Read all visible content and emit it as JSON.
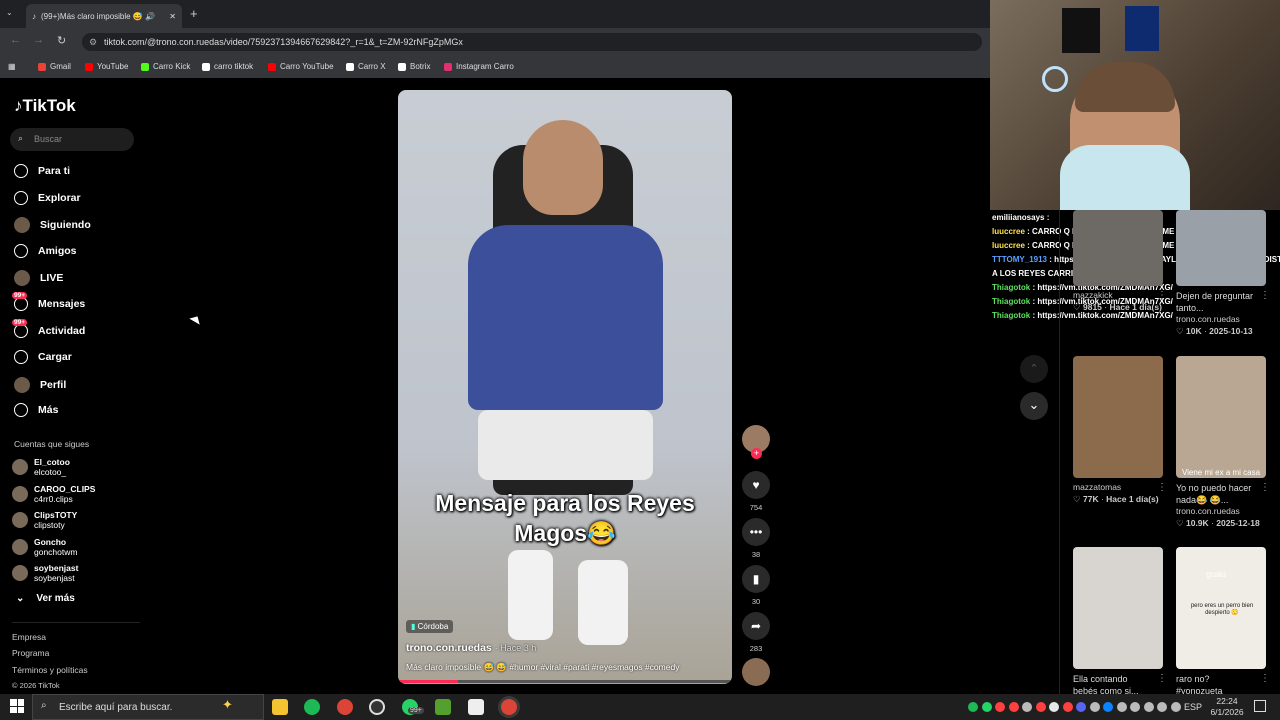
{
  "browser": {
    "tab_title": "(99+)Más claro imposible 😅 🔊",
    "url": "tiktok.com/@trono.con.ruedas/video/7592371394667629842?_r=1&_t=ZM-92rNFgZpMGx",
    "bookmarks": [
      {
        "label": "Gmail",
        "color": "#ea4335"
      },
      {
        "label": "YouTube",
        "color": "#ff0000"
      },
      {
        "label": "Carro Kick",
        "color": "#53fc18"
      },
      {
        "label": "carro tiktok",
        "color": "#ffffff"
      },
      {
        "label": "Carro YouTube",
        "color": "#ff0000"
      },
      {
        "label": "Carro X",
        "color": "#ffffff"
      },
      {
        "label": "Botrix",
        "color": "#ffffff"
      },
      {
        "label": "Instagram Carro",
        "color": "#e1306c"
      }
    ]
  },
  "tiktok": {
    "logo": "TikTok",
    "search_placeholder": "Buscar",
    "nav": [
      "Para ti",
      "Explorar",
      "Siguiendo",
      "Amigos",
      "LIVE",
      "Mensajes",
      "Actividad",
      "Cargar",
      "Perfil",
      "Más"
    ],
    "badge": "99+",
    "following_title": "Cuentas que sigues",
    "following": [
      {
        "name": "El_cotoo",
        "handle": "elcotoo_"
      },
      {
        "name": "CAROO_CLIPS",
        "handle": "c4rr0.clips"
      },
      {
        "name": "ClipsTOTY",
        "handle": "clipstoty"
      },
      {
        "name": "Goncho",
        "handle": "gonchotwm"
      },
      {
        "name": "soybenjast",
        "handle": "soybenjast"
      }
    ],
    "see_more": "Ver más",
    "footer": [
      "Empresa",
      "Programa",
      "Términos y políticas",
      "© 2026 TikTok"
    ]
  },
  "video": {
    "overlay_text": "Mensaje para los Reyes Magos😂",
    "location": "Córdoba",
    "author": "trono.con.ruedas",
    "time": "· Hace 3 h",
    "caption": "Más claro imposible 😅 😅 #humor #viral #parati #reyesmagos #comedy",
    "actions": [
      {
        "icon": "heart-icon",
        "glyph": "♥",
        "count": "754"
      },
      {
        "icon": "comment-icon",
        "glyph": "•••",
        "count": "38"
      },
      {
        "icon": "bookmark-icon",
        "glyph": "▮",
        "count": "30"
      },
      {
        "icon": "share-icon",
        "glyph": "➦",
        "count": "283"
      }
    ]
  },
  "chat": [
    {
      "user": "emiliianosays",
      "msg": "",
      "color": "#ffffff"
    },
    {
      "user": "luuccree",
      "msg": "CARRO Q DIJISTE DE ALMU QUE ME LO PERDI",
      "color": "#ffe14a"
    },
    {
      "user": "luuccree",
      "msg": "CARRO Q DIJISTE DE ALMU QUE ME LO PERDI",
      "color": "#ffe14a"
    },
    {
      "user": "TTTOMY_1913",
      "msg": "https://vm.tiktok.com/ZMDMAYL44/ Y VOS QUE LES PEDISTE",
      "color": "#5aa0ff"
    },
    {
      "user": "",
      "msg": "A LOS REYES CARRITO?",
      "color": "#ffffff"
    },
    {
      "user": "Thiagotok",
      "msg": "https://vm.tiktok.com/ZMDMAn7XG/",
      "color": "#5fe05f"
    },
    {
      "user": "Thiagotok",
      "msg": "https://vm.tiktok.com/ZMDMAn7XG/",
      "color": "#5fe05f"
    },
    {
      "user": "Thiagotok",
      "msg": "https://vm.tiktok.com/ZMDMAn7XG/",
      "color": "#5fe05f"
    }
  ],
  "related": [
    {
      "caption": "Dejen de preguntar tanto...",
      "author": "trono.con.ruedas",
      "likes": "10K",
      "date": "2025-10-13"
    },
    {
      "caption": "",
      "author": "mazzakick",
      "likes": "9815",
      "date": "Hace 1 día(s)"
    },
    {
      "caption": "",
      "author": "mazzatomas",
      "likes": "77K",
      "date": "Hace 1 día(s)"
    },
    {
      "caption": "Yo no puedo hacer nada😂 😂...",
      "author": "trono.con.ruedas",
      "likes": "10.9K",
      "date": "2025-12-18",
      "overlay": "Viene mi ex a mi casa"
    },
    {
      "caption": "Ella contando bebés como si...",
      "author": "",
      "likes": "",
      "date": ""
    },
    {
      "caption": "raro no? #yonozueta",
      "author": "",
      "likes": "",
      "date": "",
      "overlay": "guau",
      "overlay2": "pero eres un perro bien despierto 😳"
    }
  ],
  "taskbar": {
    "search": "Escribe aquí para buscar.",
    "lang": "ESP",
    "time": "22:24",
    "date": "6/1/2026",
    "badge": "99+"
  }
}
